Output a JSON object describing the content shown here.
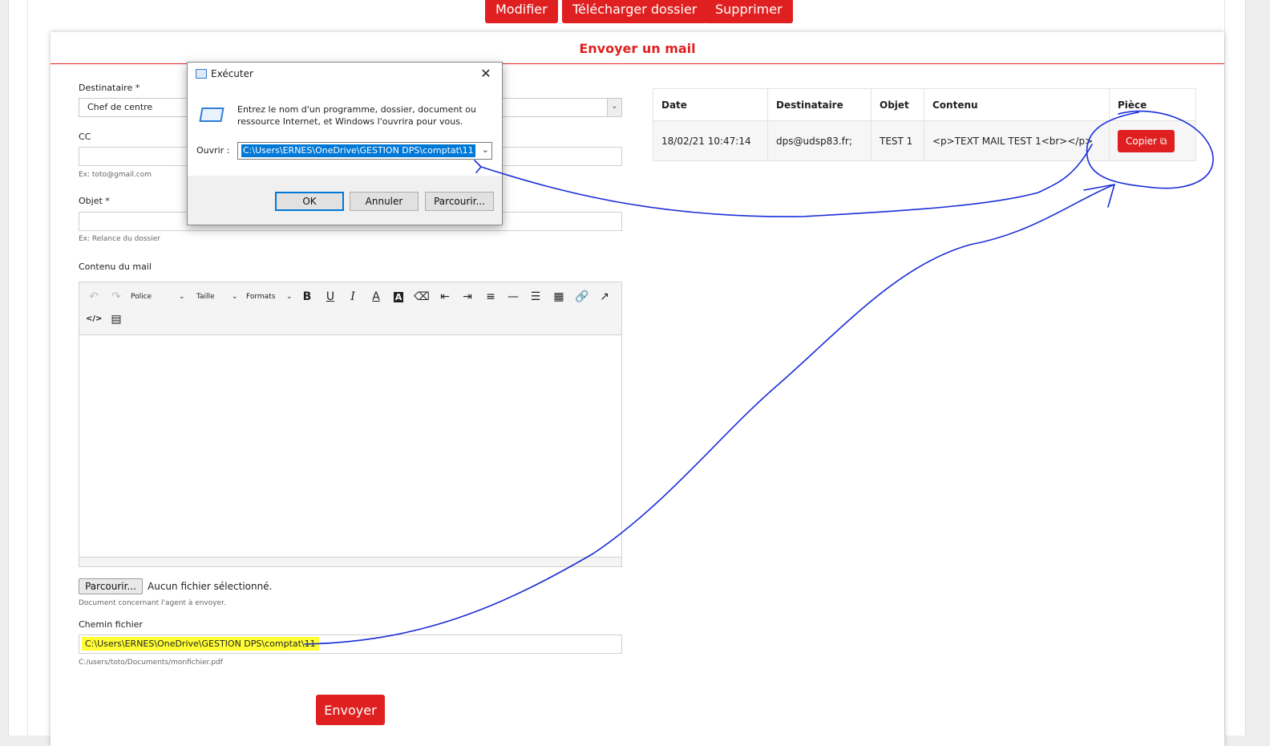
{
  "top_buttons": {
    "edit": "Modifier",
    "download": "Télécharger dossier",
    "delete": "Supprimer"
  },
  "card": {
    "title": "Envoyer un mail",
    "to_label": "Destinataire *",
    "to_value": "Chef de centre",
    "cc_label": "CC",
    "cc_hint": "Ex: toto@gmail.com",
    "subject_label": "Objet *",
    "subject_hint": "Ex: Relance du dossier",
    "content_label": "Contenu du mail",
    "file_button": "Parcourir...",
    "file_status": "Aucun fichier sélectionné.",
    "file_hint": "Document concernant l'agent à envoyer.",
    "path_label": "Chemin fichier",
    "path_value": "C:\\Users\\ERNES\\OneDrive\\GESTION DPS\\comptat\\11",
    "path_hint": "C:/users/toto/Documents/monfichier.pdf",
    "send_button": "Envoyer"
  },
  "toolbar": {
    "font": "Police",
    "size": "Taille",
    "formats": "Formats"
  },
  "mail_table": {
    "headers": [
      "Date",
      "Destinataire",
      "Objet",
      "Contenu",
      "Pièce"
    ],
    "rows": [
      {
        "date": "18/02/21 10:47:14",
        "recipient": "dps@udsp83.fr;",
        "subject": "TEST 1",
        "content": "<p>TEXT  MAIL TEST 1<br></p>",
        "attachment_button": "Copier"
      }
    ]
  },
  "run_dialog": {
    "title": "Exécuter",
    "description_line1": "Entrez le nom d'un programme, dossier, document ou",
    "description_line2": "ressource Internet, et Windows l'ouvrira pour vous.",
    "open_label": "Ouvrir :",
    "open_value": "C:\\Users\\ERNES\\OneDrive\\GESTION DPS\\comptat\\11",
    "ok": "OK",
    "cancel": "Annuler",
    "browse": "Parcourir..."
  },
  "colors": {
    "accent": "#e02020",
    "annotation": "#1a2ed8",
    "highlight": "#ffff33",
    "windows_blue": "#0078d7"
  }
}
